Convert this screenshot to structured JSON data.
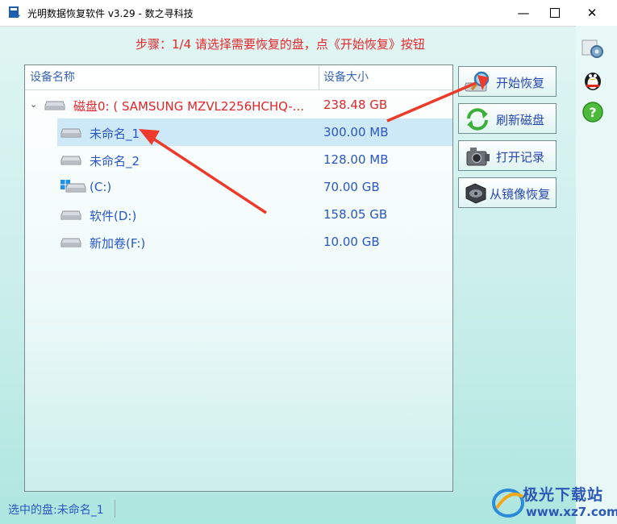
{
  "window": {
    "title": "光明数据恢复软件 v3.29 - 数之寻科技",
    "minimize": "—",
    "close": "✕"
  },
  "instruction": "步骤：1/4 请选择需要恢复的盘，点《开始恢复》按钮",
  "device_list": {
    "columns": {
      "name": "设备名称",
      "size": "设备大小"
    },
    "rows": [
      {
        "name": "磁盘0: ( SAMSUNG MZVL2256HCHQ-...",
        "size": "238.48 GB",
        "type": "disk",
        "expander": "⌄"
      },
      {
        "name": "未命名_1",
        "size": "300.00 MB",
        "type": "partition",
        "selected": true
      },
      {
        "name": "未命名_2",
        "size": "128.00 MB",
        "type": "partition"
      },
      {
        "name": "(C:)",
        "size": "70.00 GB",
        "type": "system-partition"
      },
      {
        "name": "软件(D:)",
        "size": "158.05 GB",
        "type": "partition"
      },
      {
        "name": "新加卷(F:)",
        "size": "10.00 GB",
        "type": "partition"
      }
    ]
  },
  "buttons": {
    "start_recovery": "开始恢复",
    "refresh_disks": "刷新磁盘",
    "open_record": "打开记录",
    "restore_from_image": "从镜像恢复"
  },
  "status": {
    "selected": "选中的盘:未命名_1"
  },
  "watermark": {
    "title": "极光下载站",
    "url": "www.xz7.com"
  },
  "colors": {
    "accent_red": "#e8262b",
    "text_blue": "#2a56c6",
    "selection": "#cde8f7",
    "background": "#c8eeea"
  }
}
